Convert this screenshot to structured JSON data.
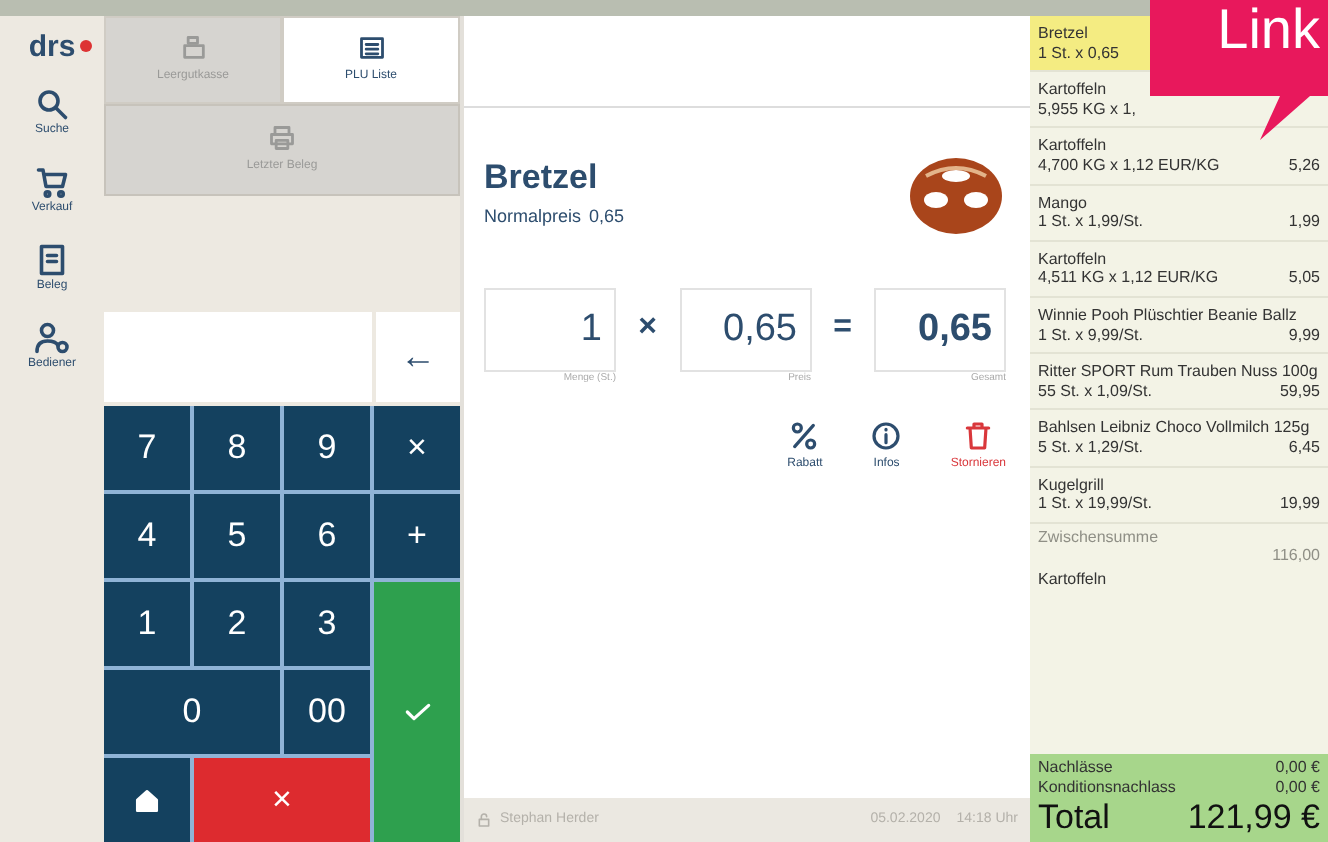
{
  "sidebar": {
    "logo": "drs",
    "items": [
      {
        "label": "Suche"
      },
      {
        "label": "Verkauf"
      },
      {
        "label": "Beleg"
      },
      {
        "label": "Bediener"
      }
    ]
  },
  "tabs": [
    {
      "label": "Leergutkasse",
      "selected": false
    },
    {
      "label": "PLU Liste",
      "selected": true
    }
  ],
  "last_receipt_button": "Letzter Beleg",
  "display": {
    "backspace": "←"
  },
  "keypad": [
    {
      "label": "7",
      "kind": "digit"
    },
    {
      "label": "8",
      "kind": "digit"
    },
    {
      "label": "9",
      "kind": "digit"
    },
    {
      "label": "×",
      "kind": "operator"
    },
    {
      "label": "4",
      "kind": "digit"
    },
    {
      "label": "5",
      "kind": "digit"
    },
    {
      "label": "6",
      "kind": "digit"
    },
    {
      "label": "+",
      "kind": "operator"
    },
    {
      "label": "1",
      "kind": "digit"
    },
    {
      "label": "2",
      "kind": "digit"
    },
    {
      "label": "3",
      "kind": "digit"
    },
    {
      "kind": "confirm"
    },
    {
      "label": "0",
      "kind": "digit",
      "wide": true
    },
    {
      "label": "00",
      "kind": "digit"
    },
    {
      "kind": "home"
    },
    {
      "label": "×",
      "kind": "cancel"
    }
  ],
  "product": {
    "name": "Bretzel",
    "normal_price_label": "Normalpreis",
    "normal_price": "0,65"
  },
  "calculation": {
    "quantity": "1",
    "quantity_label": "Menge (St.)",
    "times": "×",
    "price": "0,65",
    "price_label": "Preis",
    "equals": "=",
    "total": "0,65",
    "total_label": "Gesamt"
  },
  "actions": [
    {
      "label": "Rabatt",
      "kind": "discount"
    },
    {
      "label": "Infos",
      "kind": "info"
    },
    {
      "label": "Stornieren",
      "kind": "delete"
    }
  ],
  "footer": {
    "user": "Stephan Herder",
    "date": "05.02.2020",
    "time": "14:18 Uhr"
  },
  "receipt": {
    "items": [
      {
        "name": "Bretzel",
        "detail": "1 St. x 0,65",
        "selected": true
      },
      {
        "name": "Kartoffeln",
        "detail": "5,955 KG x 1,",
        "selected": false
      },
      {
        "name": "Kartoffeln",
        "detail": "4,700 KG x 1,12 EUR/KG",
        "amount": "5,26",
        "selected": false
      },
      {
        "name": "Mango",
        "detail": "1 St. x 1,99/St.",
        "amount": "1,99",
        "selected": false
      },
      {
        "name": "Kartoffeln",
        "detail": "4,511 KG x 1,12 EUR/KG",
        "amount": "5,05",
        "selected": false
      },
      {
        "name": "Winnie Pooh Plüschtier Beanie Ballz",
        "detail": "1 St. x 9,99/St.",
        "amount": "9,99",
        "selected": false
      },
      {
        "name": "Ritter SPORT Rum Trauben Nuss 100g",
        "detail": "55 St. x 1,09/St.",
        "amount": "59,95",
        "selected": false
      },
      {
        "name": "Bahlsen Leibniz Choco Vollmilch 125g",
        "detail": "5 St. x 1,29/St.",
        "amount": "6,45",
        "selected": false
      },
      {
        "name": "Kugelgrill",
        "detail": "1 St. x 19,99/St.",
        "amount": "19,99",
        "selected": false
      }
    ],
    "subtotal": {
      "label": "Zwischensumme",
      "amount": "116,00"
    },
    "next_item": "Kartoffeln",
    "discounts": [
      {
        "label": "Nachlässe",
        "amount": "0,00 €"
      },
      {
        "label": "Konditionsnachlass",
        "amount": "0,00 €"
      }
    ],
    "total": {
      "label": "Total",
      "amount": "121,99 €"
    }
  },
  "callout": {
    "text": "Link"
  }
}
